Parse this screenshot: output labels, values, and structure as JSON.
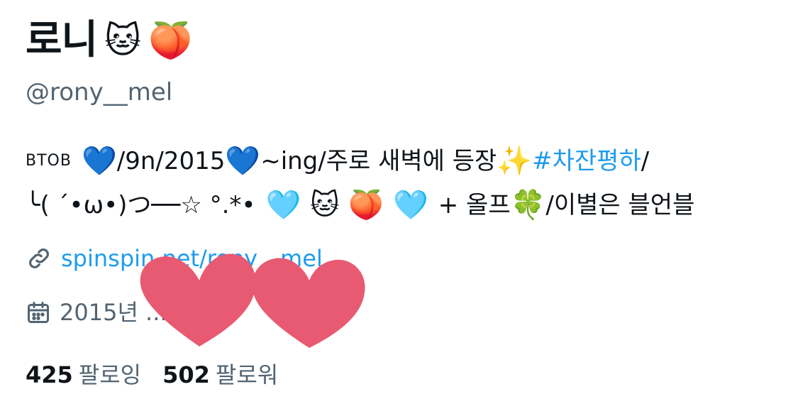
{
  "profile": {
    "display_name": "로니",
    "name_emojis": [
      "🐱",
      "🍑"
    ],
    "handle": "@rony__mel",
    "bio": {
      "line1": {
        "prefix": "BTOB",
        "heart1": "💙",
        "date": "/9n/2015",
        "heart2": "💙",
        "text": "~ing/주로 새벽에 등장",
        "sparkles": "✨",
        "hashtag": "#차잔평하",
        "suffix": "/"
      },
      "line2": {
        "kaomoji": "╰( ´•ω•)つ──☆ °.*•",
        "emojis": "🩵 🐱 🍑 🩵",
        "plus": "+ 올프",
        "clover": "🍀",
        "text": "/이별은 블언블"
      }
    },
    "link": {
      "icon": "link-icon",
      "text": "spinspin.net/rony__mel"
    },
    "joined": {
      "icon": "calendar-icon",
      "text": "2015년 ... 가입"
    },
    "stats": {
      "following_count": "425",
      "following_label": "팔로잉",
      "followers_count": "502",
      "followers_label": "팔로워"
    }
  },
  "colors": {
    "text": "#0f1419",
    "secondary": "#536471",
    "accent": "#1d9bf0",
    "heart_sticker": "#e85a72"
  }
}
